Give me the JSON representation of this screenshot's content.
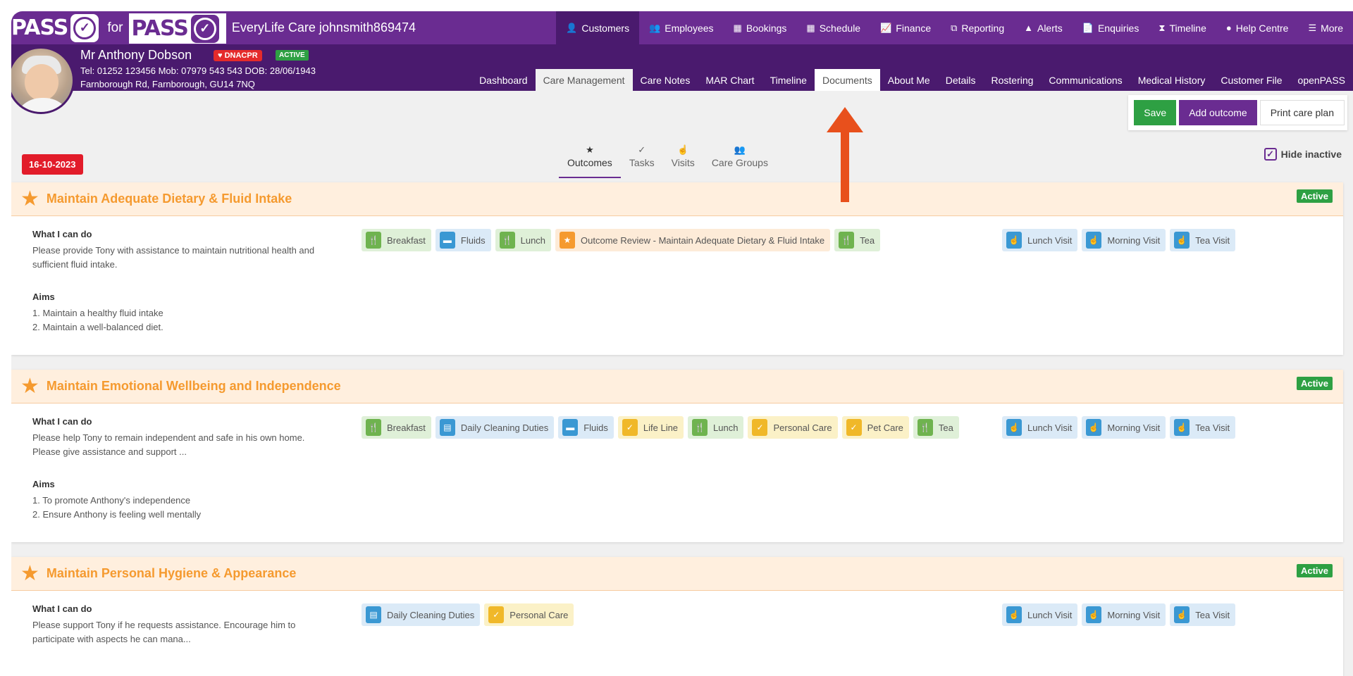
{
  "brand": {
    "pass1": "PASS",
    "for": "for",
    "pass2": "PASS",
    "app_title": "EveryLife Care johnsmith869474"
  },
  "main_nav": [
    {
      "label": "Customers",
      "icon": "👤",
      "active": true
    },
    {
      "label": "Employees",
      "icon": "👥"
    },
    {
      "label": "Bookings",
      "icon": "▦"
    },
    {
      "label": "Schedule",
      "icon": "▦"
    },
    {
      "label": "Finance",
      "icon": "📈"
    },
    {
      "label": "Reporting",
      "icon": "⧉"
    },
    {
      "label": "Alerts",
      "icon": "▲"
    },
    {
      "label": "Enquiries",
      "icon": "📄"
    },
    {
      "label": "Timeline",
      "icon": "⧗"
    },
    {
      "label": "Help Centre",
      "icon": "●"
    },
    {
      "label": "More",
      "icon": "☰"
    }
  ],
  "customer": {
    "name": "Mr Anthony Dobson",
    "dnacpr": "♥ DNACPR",
    "status": "ACTIVE",
    "contact": "Tel: 01252 123456  Mob: 07979 543 543  DOB: 28/06/1943",
    "address": "Farnborough Rd, Farnborough, GU14 7NQ"
  },
  "sub_nav": [
    "Dashboard",
    "Care Management",
    "Care Notes",
    "MAR Chart",
    "Timeline",
    "Documents",
    "About Me",
    "Details",
    "Rostering",
    "Communications",
    "Medical History",
    "Customer File",
    "openPASS"
  ],
  "actions": {
    "save": "Save",
    "add": "Add outcome",
    "print": "Print care plan"
  },
  "date": "16-10-2023",
  "tabs": [
    {
      "label": "Outcomes",
      "icon": "★",
      "active": true
    },
    {
      "label": "Tasks",
      "icon": "✓"
    },
    {
      "label": "Visits",
      "icon": "☝"
    },
    {
      "label": "Care Groups",
      "icon": "👥"
    }
  ],
  "hide_inactive": "Hide inactive",
  "labels": {
    "what": "What I can do",
    "aims": "Aims"
  },
  "outcomes": [
    {
      "title": "Maintain Adequate Dietary & Fluid Intake",
      "status": "Active",
      "what": "Please provide Tony with assistance to maintain nutritional health and sufficient fluid intake.",
      "aims": [
        "1. Maintain a healthy fluid intake",
        "2. Maintain a well-balanced diet."
      ],
      "tasks": [
        {
          "label": "Breakfast",
          "color": "green",
          "icon": "🍴"
        },
        {
          "label": "Fluids",
          "color": "blue",
          "icon": "▬"
        },
        {
          "label": "Lunch",
          "color": "green",
          "icon": "🍴"
        },
        {
          "label": "Outcome Review - Maintain Adequate Dietary & Fluid Intake",
          "color": "orange",
          "icon": "★"
        },
        {
          "label": "Tea",
          "color": "green",
          "icon": "🍴"
        }
      ],
      "visits": [
        "Lunch Visit",
        "Morning Visit",
        "Tea Visit"
      ]
    },
    {
      "title": "Maintain Emotional Wellbeing and Independence",
      "status": "Active",
      "what": "Please help Tony to remain independent and safe in his own home. Please give assistance and support ...",
      "aims": [
        "1. To promote Anthony's independence",
        "2. Ensure Anthony is feeling well mentally"
      ],
      "tasks": [
        {
          "label": "Breakfast",
          "color": "green",
          "icon": "🍴"
        },
        {
          "label": "Daily Cleaning Duties",
          "color": "blue",
          "icon": "▤"
        },
        {
          "label": "Fluids",
          "color": "blue",
          "icon": "▬"
        },
        {
          "label": "Life Line",
          "color": "yellow",
          "icon": "✓"
        },
        {
          "label": "Lunch",
          "color": "green",
          "icon": "🍴"
        },
        {
          "label": "Personal Care",
          "color": "yellow",
          "icon": "✓"
        },
        {
          "label": "Pet Care",
          "color": "yellow",
          "icon": "✓"
        },
        {
          "label": "Tea",
          "color": "green",
          "icon": "🍴"
        }
      ],
      "visits": [
        "Lunch Visit",
        "Morning Visit",
        "Tea Visit"
      ]
    },
    {
      "title": "Maintain Personal Hygiene & Appearance",
      "status": "Active",
      "what": "Please support Tony if he requests assistance. Encourage him to participate with aspects he can mana...",
      "aims": [],
      "tasks": [
        {
          "label": "Daily Cleaning Duties",
          "color": "blue",
          "icon": "▤"
        },
        {
          "label": "Personal Care",
          "color": "yellow",
          "icon": "✓"
        }
      ],
      "visits": [
        "Lunch Visit",
        "Morning Visit",
        "Tea Visit"
      ]
    }
  ],
  "colors": {
    "brand_purple": "#6a2c91",
    "dark_purple": "#4a1a6e",
    "accent_orange": "#f59a2f",
    "arrow_red": "#e8501c",
    "active_green": "#2ea043",
    "date_red": "#e21c2a"
  }
}
